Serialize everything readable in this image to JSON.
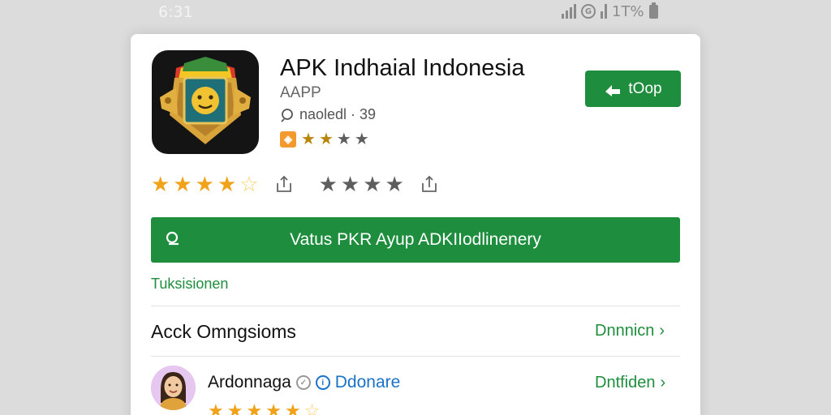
{
  "colors": {
    "accent_green": "#1e8e3e",
    "star_gold": "#f0a21a",
    "star_grey": "#5e5e5e",
    "badge_blue": "#1a73c8"
  },
  "status_bar": {
    "time": "6:31",
    "right_text": "1T%",
    "icons": [
      "signal-icon",
      "g-circle-icon",
      "signal-icon",
      "battery-icon"
    ]
  },
  "app": {
    "title": "APK Indhaial Indonesia",
    "subtitle": "AAPP",
    "meta_icon": "search-outline-icon",
    "meta_text": "naoledl · 39",
    "badge_icon": "app-badge-icon",
    "stars": {
      "filled": 2,
      "total": 4
    },
    "top_button": {
      "icon": "download-arrow-icon",
      "label": "tOop"
    }
  },
  "ratings": {
    "first": {
      "filled": 4,
      "half": 1,
      "total": 5,
      "color": "gold",
      "share_icon": "share-icon"
    },
    "second": {
      "filled": 0,
      "total": 4,
      "color": "grey",
      "share_icon": "share-icon"
    }
  },
  "main_button": {
    "icon": "search-icon",
    "label": "Vatus PKR Ayup ADKIIodlinenery"
  },
  "section_label": "Tuksisionen",
  "row_options": {
    "title": "Acck Omngsioms",
    "link": "Dnnnicn"
  },
  "review": {
    "avatar": "avatar",
    "name": "Ardonnaga",
    "badge_label": "Ddonare",
    "link": "Dntfiden",
    "stars": {
      "filled": 5,
      "total": 6
    }
  }
}
